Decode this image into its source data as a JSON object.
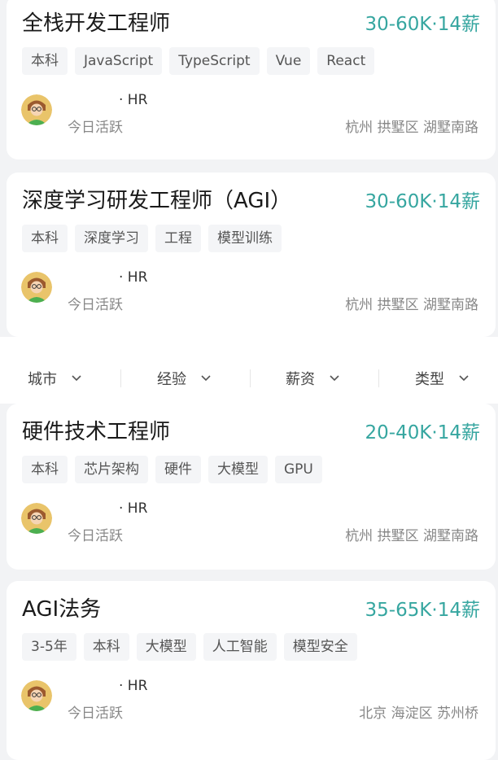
{
  "jobs": [
    {
      "title": "全栈开发工程师",
      "salary": "30-60K·14薪",
      "tags": [
        "本科",
        "JavaScript",
        "TypeScript",
        "Vue",
        "React"
      ],
      "recruiter": "· HR",
      "status": "今日活跃",
      "location": "杭州  拱墅区  湖墅南路"
    },
    {
      "title": "深度学习研发工程师（AGI）",
      "salary": "30-60K·14薪",
      "tags": [
        "本科",
        "深度学习",
        "工程",
        "模型训练"
      ],
      "recruiter": "· HR",
      "status": "今日活跃",
      "location": "杭州  拱墅区  湖墅南路"
    },
    {
      "title": "硬件技术工程师",
      "salary": "20-40K·14薪",
      "tags": [
        "本科",
        "芯片架构",
        "硬件",
        "大模型",
        "GPU"
      ],
      "recruiter": "· HR",
      "status": "今日活跃",
      "location": "杭州  拱墅区  湖墅南路"
    },
    {
      "title": "AGI法务",
      "salary": "35-65K·14薪",
      "tags": [
        "3-5年",
        "本科",
        "大模型",
        "人工智能",
        "模型安全"
      ],
      "recruiter": "· HR",
      "status": "今日活跃",
      "location": "北京  海淀区  苏州桥"
    }
  ],
  "filters": [
    "城市",
    "经验",
    "薪资",
    "类型"
  ],
  "colors": {
    "salary": "#36a6a0",
    "background": "#f2f3f5",
    "tag_bg": "#f4f5f7"
  },
  "icons": {
    "avatar": "avatar-icon",
    "dropdown": "chevron-down-icon"
  }
}
